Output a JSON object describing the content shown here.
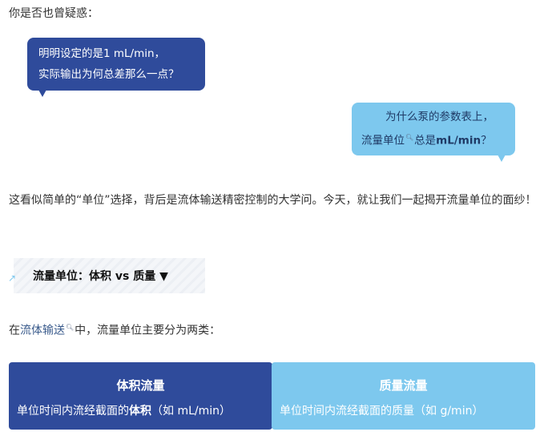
{
  "intro": "你是否也曾疑惑：",
  "bubble_left": {
    "line1": "明明设定的是1 mL/min，",
    "line2": "实际输出为何总差那么一点？"
  },
  "bubble_right": {
    "line1": "为什么泵的参数表上，",
    "line2_pre": "流量单位",
    "line2_mid": "总是",
    "line2_bold": "mL/min",
    "line2_post": "？"
  },
  "paragraph": "这看似简单的“单位”选择，背后是流体输送精密控制的大学问。今天，就让我们一起揭开流量单位的面纱！",
  "section": {
    "title": "流量单位：体积 vs 质量 ▼"
  },
  "para2": {
    "pre": "在",
    "link": "流体输送",
    "post": "中，流量单位主要分为两类："
  },
  "cards": [
    {
      "title": "体积流量",
      "desc_pre": "单位时间内流经截面的",
      "desc_bold": "体积",
      "desc_post": "（如 mL/min）"
    },
    {
      "title": "质量流量",
      "desc_pre": "单位时间内流经截面的",
      "desc_bold": "质量",
      "desc_post": "（如 g/min）"
    }
  ],
  "colors": {
    "dark_blue": "#2f4b9b",
    "light_blue": "#7dc8ee"
  }
}
